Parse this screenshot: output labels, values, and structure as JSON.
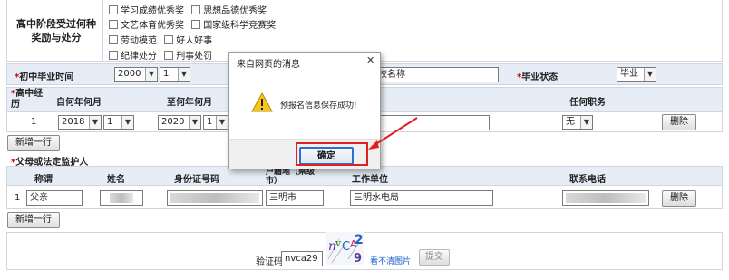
{
  "awards": {
    "label": "高中阶段受过何种奖励与处分",
    "options_row1": [
      "学习成绩优秀奖",
      "思想品德优秀奖"
    ],
    "options_row2": [
      "文艺体育优秀奖",
      "国家级科学竞赛奖"
    ],
    "options_row3": [
      "劳动模范",
      "好人好事"
    ],
    "options_row4": [
      "纪律处分",
      "刑事处罚"
    ]
  },
  "junior": {
    "grad_time_label": "初中毕业时间",
    "year": "2000",
    "month": "1",
    "school_partial": "业学校名称",
    "status_label": "毕业状态",
    "status_value": "毕业"
  },
  "hs_history": {
    "label": "高中经历",
    "col_from": "自何年何月",
    "col_to": "至何年何月",
    "col_role": "任何职务",
    "row_index": "1",
    "from_year": "2018",
    "from_month": "1",
    "to_year": "2020",
    "to_month": "1",
    "role_value": "无",
    "delete_label": "删除",
    "add_label": "新增一行"
  },
  "guardian": {
    "section_label": "父母或法定监护人",
    "col_title": "称谓",
    "col_name": "姓名",
    "col_id": "身份证号码",
    "col_addr": "户籍地（県级市）",
    "col_work": "工作单位",
    "col_phone": "联系电话",
    "row_index": "1",
    "title_value": "父亲",
    "addr_value": "三明市",
    "work_value": "三明水电局",
    "delete_label": "删除",
    "add_label": "新增一行"
  },
  "captcha": {
    "label": "验证码",
    "value": "nvca29",
    "image_text": "nvCA29",
    "refresh_link": "看不清图片",
    "submit_label": "提交"
  },
  "dialog": {
    "title": "来自网页的消息",
    "close_glyph": "✕",
    "message": "预报名信息保存成功!",
    "ok_label": "确定",
    "icon": "warning-icon"
  },
  "colors": {
    "header_band": "#e6edf6",
    "required_star": "#d00000",
    "annotation_red": "#e0201e",
    "ok_border": "#2a6fd6"
  }
}
